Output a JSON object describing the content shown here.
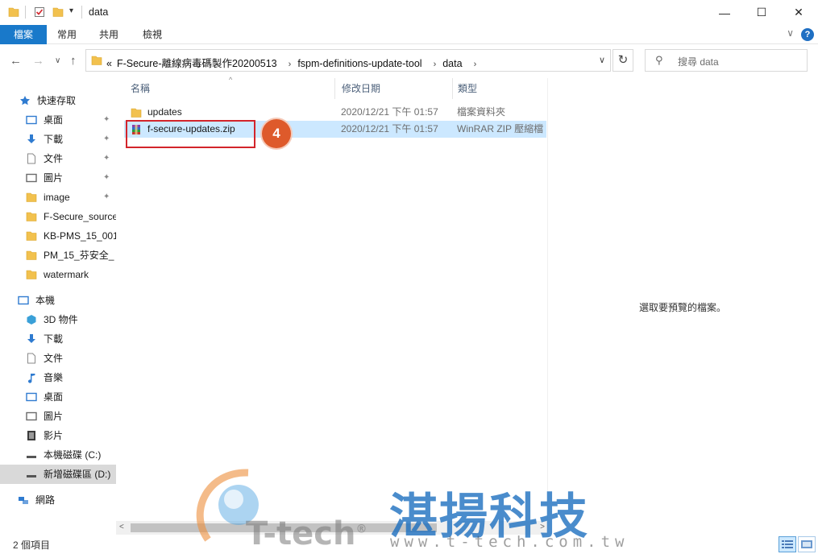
{
  "window": {
    "title": "data",
    "minimize": "—",
    "maximize": "☐",
    "close": "✕"
  },
  "ribbon": {
    "tabs": [
      "檔案",
      "常用",
      "共用",
      "檢視"
    ],
    "help": "?",
    "chevron": "∨"
  },
  "address": {
    "prefix": "«",
    "parts": [
      "F-Secure-離線病毒碼製作20200513",
      "fspm-definitions-update-tool",
      "data"
    ],
    "separator": "›",
    "dropdown": "∨",
    "refresh": "↻"
  },
  "search": {
    "placeholder": "搜尋 data"
  },
  "sidebar": {
    "items": [
      {
        "label": "快速存取",
        "icon": "star-icon",
        "pinned": false
      },
      {
        "label": "桌面",
        "icon": "desktop-icon",
        "pinned": true
      },
      {
        "label": "下載",
        "icon": "download-icon",
        "pinned": true
      },
      {
        "label": "文件",
        "icon": "document-icon",
        "pinned": true
      },
      {
        "label": "圖片",
        "icon": "picture-icon",
        "pinned": true
      },
      {
        "label": "image",
        "icon": "folder-icon",
        "pinned": true
      },
      {
        "label": "F-Secure_source",
        "icon": "folder-icon",
        "pinned": false
      },
      {
        "label": "KB-PMS_15_001",
        "icon": "folder-icon",
        "pinned": false
      },
      {
        "label": "PM_15_芬安全_",
        "icon": "folder-icon",
        "pinned": false
      },
      {
        "label": "watermark",
        "icon": "folder-icon",
        "pinned": false
      },
      {
        "label": "本機",
        "icon": "computer-icon",
        "pinned": false
      },
      {
        "label": "3D 物件",
        "icon": "cube-icon",
        "pinned": false
      },
      {
        "label": "下載",
        "icon": "download-icon",
        "pinned": false
      },
      {
        "label": "文件",
        "icon": "document-icon",
        "pinned": false
      },
      {
        "label": "音樂",
        "icon": "music-icon",
        "pinned": false
      },
      {
        "label": "桌面",
        "icon": "desktop-icon",
        "pinned": false
      },
      {
        "label": "圖片",
        "icon": "picture-icon",
        "pinned": false
      },
      {
        "label": "影片",
        "icon": "video-icon",
        "pinned": false
      },
      {
        "label": "本機磁碟 (C:)",
        "icon": "drive-icon",
        "pinned": false
      },
      {
        "label": "新增磁碟區 (D:)",
        "icon": "drive-icon",
        "pinned": false
      },
      {
        "label": "網路",
        "icon": "network-icon",
        "pinned": false
      }
    ],
    "pin_glyph": "📌"
  },
  "filelist": {
    "columns": [
      "名稱",
      "修改日期",
      "類型"
    ],
    "sort_indicator": "^",
    "rows": [
      {
        "name": "updates",
        "date": "2020/12/21 下午 01:57",
        "type": "檔案資料夾",
        "icon": "folder-icon"
      },
      {
        "name": "f-secure-updates.zip",
        "date": "2020/12/21 下午 01:57",
        "type": "WinRAR ZIP 壓縮檔",
        "icon": "winrar-archive-icon"
      }
    ]
  },
  "annotation": {
    "step": "4"
  },
  "preview": {
    "message": "選取要預覽的檔案。"
  },
  "scrollbar": {
    "left": "<",
    "right": ">"
  },
  "status": {
    "item_count": "2 個項目"
  },
  "watermark": {
    "company": "湛揚科技",
    "logo": "T-tech",
    "registered": "®",
    "url": "www.t-tech.com.tw"
  },
  "colors": {
    "accent": "#1979ca",
    "selection": "#cce8ff",
    "highlight": "#d3252b",
    "badge": "#de5a2b",
    "folder": "#f2c14e"
  }
}
